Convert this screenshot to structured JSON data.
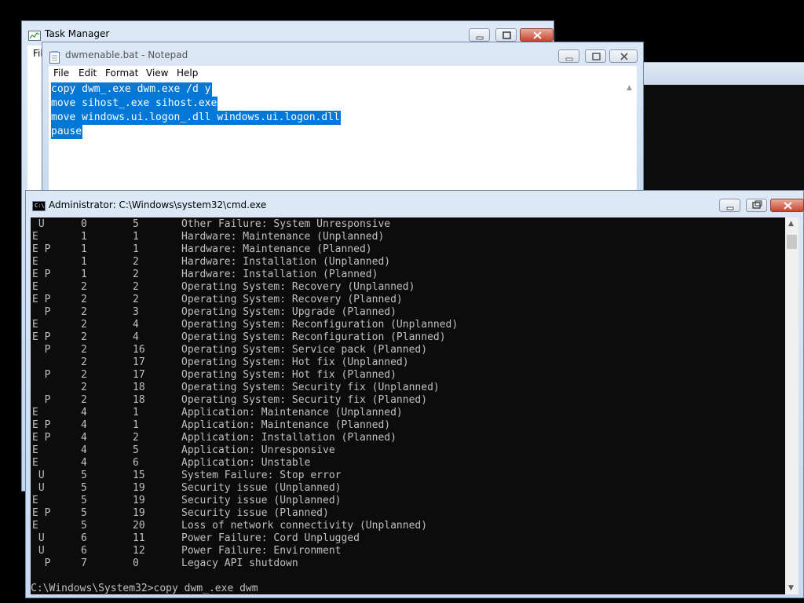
{
  "taskmgr": {
    "title": "Task Manager",
    "menu_fragment": "Fil"
  },
  "notepad": {
    "title": "dwmenable.bat - Notepad",
    "menu": [
      "File",
      "Edit",
      "Format",
      "View",
      "Help"
    ],
    "lines": [
      "copy dwm_.exe dwm.exe /d y",
      "move sihost_.exe sihost.exe",
      "move windows.ui.logon_.dll windows.ui.logon.dll",
      "pause"
    ],
    "selected": true,
    "selection_color": "#0078d7"
  },
  "cmd": {
    "title": "Administrator: C:\\Windows\\system32\\cmd.exe",
    "rows": [
      {
        "flags": " U",
        "major": "0",
        "minor": "5",
        "desc": "Other Failure: System Unresponsive"
      },
      {
        "flags": "E",
        "major": "1",
        "minor": "1",
        "desc": "Hardware: Maintenance (Unplanned)"
      },
      {
        "flags": "E P",
        "major": "1",
        "minor": "1",
        "desc": "Hardware: Maintenance (Planned)"
      },
      {
        "flags": "E",
        "major": "1",
        "minor": "2",
        "desc": "Hardware: Installation (Unplanned)"
      },
      {
        "flags": "E P",
        "major": "1",
        "minor": "2",
        "desc": "Hardware: Installation (Planned)"
      },
      {
        "flags": "E",
        "major": "2",
        "minor": "2",
        "desc": "Operating System: Recovery (Unplanned)"
      },
      {
        "flags": "E P",
        "major": "2",
        "minor": "2",
        "desc": "Operating System: Recovery (Planned)"
      },
      {
        "flags": "  P",
        "major": "2",
        "minor": "3",
        "desc": "Operating System: Upgrade (Planned)"
      },
      {
        "flags": "E",
        "major": "2",
        "minor": "4",
        "desc": "Operating System: Reconfiguration (Unplanned)"
      },
      {
        "flags": "E P",
        "major": "2",
        "minor": "4",
        "desc": "Operating System: Reconfiguration (Planned)"
      },
      {
        "flags": "  P",
        "major": "2",
        "minor": "16",
        "desc": "Operating System: Service pack (Planned)"
      },
      {
        "flags": "",
        "major": "2",
        "minor": "17",
        "desc": "Operating System: Hot fix (Unplanned)"
      },
      {
        "flags": "  P",
        "major": "2",
        "minor": "17",
        "desc": "Operating System: Hot fix (Planned)"
      },
      {
        "flags": "",
        "major": "2",
        "minor": "18",
        "desc": "Operating System: Security fix (Unplanned)"
      },
      {
        "flags": "  P",
        "major": "2",
        "minor": "18",
        "desc": "Operating System: Security fix (Planned)"
      },
      {
        "flags": "E",
        "major": "4",
        "minor": "1",
        "desc": "Application: Maintenance (Unplanned)"
      },
      {
        "flags": "E P",
        "major": "4",
        "minor": "1",
        "desc": "Application: Maintenance (Planned)"
      },
      {
        "flags": "E P",
        "major": "4",
        "minor": "2",
        "desc": "Application: Installation (Planned)"
      },
      {
        "flags": "E",
        "major": "4",
        "minor": "5",
        "desc": "Application: Unresponsive"
      },
      {
        "flags": "E",
        "major": "4",
        "minor": "6",
        "desc": "Application: Unstable"
      },
      {
        "flags": " U",
        "major": "5",
        "minor": "15",
        "desc": "System Failure: Stop error"
      },
      {
        "flags": " U",
        "major": "5",
        "minor": "19",
        "desc": "Security issue (Unplanned)"
      },
      {
        "flags": "E",
        "major": "5",
        "minor": "19",
        "desc": "Security issue (Unplanned)"
      },
      {
        "flags": "E P",
        "major": "5",
        "minor": "19",
        "desc": "Security issue (Planned)"
      },
      {
        "flags": "E",
        "major": "5",
        "minor": "20",
        "desc": "Loss of network connectivity (Unplanned)"
      },
      {
        "flags": " U",
        "major": "6",
        "minor": "11",
        "desc": "Power Failure: Cord Unplugged"
      },
      {
        "flags": " U",
        "major": "6",
        "minor": "12",
        "desc": "Power Failure: Environment"
      },
      {
        "flags": "  P",
        "major": "7",
        "minor": "0",
        "desc": "Legacy API shutdown"
      }
    ],
    "prompt": "C:\\Windows\\System32>copy dwm_.exe dwm",
    "icon_label": "C:\\"
  }
}
